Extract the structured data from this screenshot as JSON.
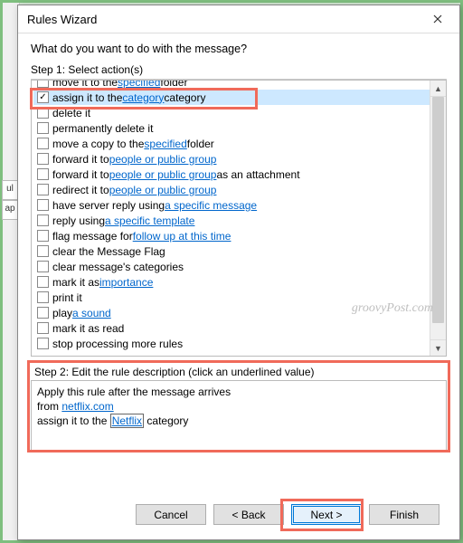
{
  "dialog": {
    "title": "Rules Wizard",
    "question": "What do you want to do with the message?",
    "step1_label": "Step 1: Select action(s)",
    "step2_label": "Step 2: Edit the rule description (click an underlined value)"
  },
  "actions": [
    {
      "checked": false,
      "pre": "move it to the ",
      "link": "specified",
      "post": " folder",
      "cut": true
    },
    {
      "checked": true,
      "pre": "assign it to the ",
      "link": "category",
      "post": " category",
      "selected": true
    },
    {
      "checked": false,
      "pre": "delete it",
      "link": "",
      "post": ""
    },
    {
      "checked": false,
      "pre": "permanently delete it",
      "link": "",
      "post": ""
    },
    {
      "checked": false,
      "pre": "move a copy to the ",
      "link": "specified",
      "post": " folder"
    },
    {
      "checked": false,
      "pre": "forward it to ",
      "link": "people or public group",
      "post": ""
    },
    {
      "checked": false,
      "pre": "forward it to ",
      "link": "people or public group",
      "post": " as an attachment"
    },
    {
      "checked": false,
      "pre": "redirect it to ",
      "link": "people or public group",
      "post": ""
    },
    {
      "checked": false,
      "pre": "have server reply using ",
      "link": "a specific message",
      "post": ""
    },
    {
      "checked": false,
      "pre": "reply using ",
      "link": "a specific template",
      "post": ""
    },
    {
      "checked": false,
      "pre": "flag message for ",
      "link": "follow up at this time",
      "post": ""
    },
    {
      "checked": false,
      "pre": "clear the Message Flag",
      "link": "",
      "post": ""
    },
    {
      "checked": false,
      "pre": "clear message's categories",
      "link": "",
      "post": ""
    },
    {
      "checked": false,
      "pre": "mark it as ",
      "link": "importance",
      "post": ""
    },
    {
      "checked": false,
      "pre": "print it",
      "link": "",
      "post": ""
    },
    {
      "checked": false,
      "pre": "play ",
      "link": "a sound",
      "post": ""
    },
    {
      "checked": false,
      "pre": "mark it as read",
      "link": "",
      "post": ""
    },
    {
      "checked": false,
      "pre": "stop processing more rules",
      "link": "",
      "post": ""
    }
  ],
  "description": {
    "line1": "Apply this rule after the message arrives",
    "line2_pre": "from ",
    "line2_link": "netflix.com",
    "line3_pre": "assign it to the ",
    "line3_link": "Netflix",
    "line3_post": " category"
  },
  "buttons": {
    "cancel": "Cancel",
    "back": "< Back",
    "next": "Next >",
    "finish": "Finish"
  },
  "bg_tabs": {
    "t1": "ul",
    "t2": "ap"
  },
  "watermark": "groovyPost.com"
}
